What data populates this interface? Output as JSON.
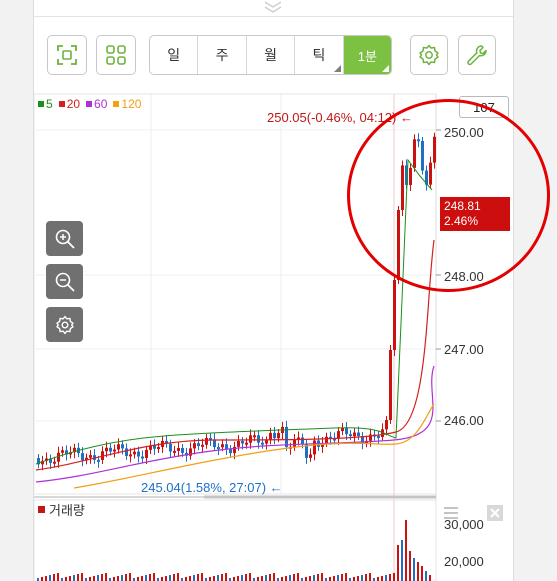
{
  "timeframes": [
    {
      "label": "일",
      "has_submenu": false,
      "active": false
    },
    {
      "label": "주",
      "has_submenu": false,
      "active": false
    },
    {
      "label": "월",
      "has_submenu": false,
      "active": false
    },
    {
      "label": "틱",
      "has_submenu": true,
      "active": false
    },
    {
      "label": "1분",
      "has_submenu": true,
      "active": true
    }
  ],
  "toolbar_icons": [
    "fullscreen-icon",
    "grid-layout-icon",
    "settings-icon",
    "wrench-icon"
  ],
  "legend": [
    {
      "label": "5",
      "color": "#1a8f1a"
    },
    {
      "label": "20",
      "color": "#d42020"
    },
    {
      "label": "60",
      "color": "#b030d8"
    },
    {
      "label": "120",
      "color": "#f0a010"
    }
  ],
  "price_box": "107",
  "high_annotation": "250.05(-0.46%, 04:12)",
  "low_annotation": "245.04(1.58%, 27:07)",
  "current_price": {
    "price": "248.81",
    "change": "2.46%"
  },
  "y_axis_labels": [
    "250.00",
    "248.00",
    "247.00",
    "246.00"
  ],
  "volume": {
    "title": "거래량",
    "axis_labels": [
      "30,000",
      "20,000"
    ]
  },
  "colors": {
    "accent": "#7cc142",
    "up": "#cc1111",
    "down": "#1f6fc7",
    "highlight_circle": "#e30000"
  }
}
